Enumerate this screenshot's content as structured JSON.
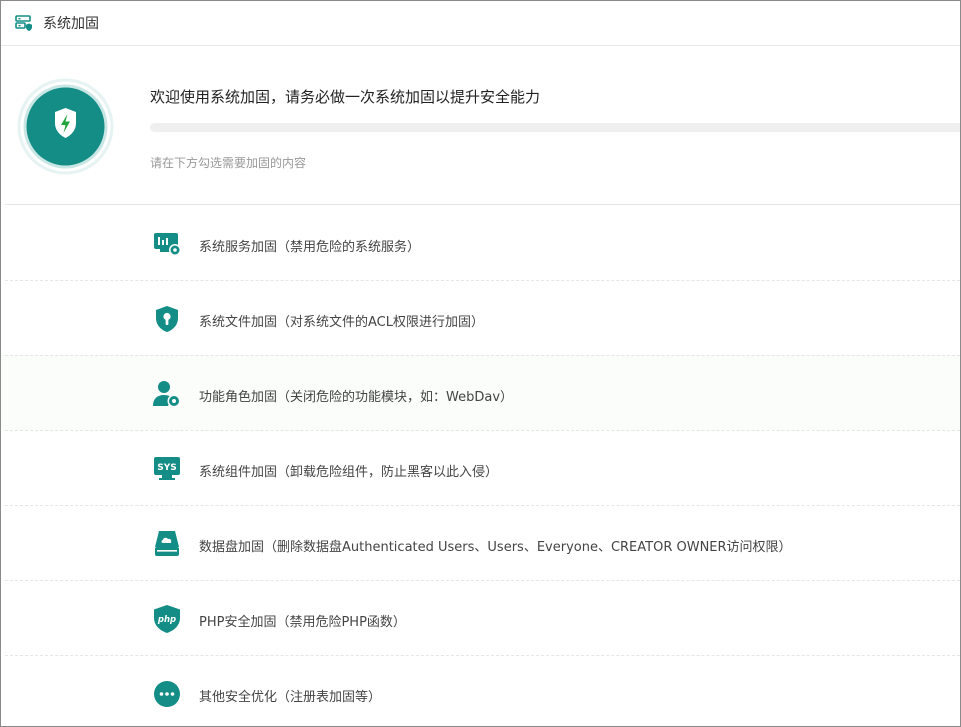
{
  "header": {
    "title": "系统加固",
    "icon": "server-shield-icon"
  },
  "hero": {
    "title": "欢迎使用系统加固，请务必做一次系统加固以提升安全能力",
    "subtitle": "请在下方勾选需要加固的内容",
    "progress": 0,
    "icon": "shield-bolt-icon"
  },
  "colors": {
    "accent": "#138d86",
    "accent_dark": "#0e7a73",
    "progress": "#20a53a"
  },
  "items": [
    {
      "label": "系统服务加固（禁用危险的系统服务）",
      "icon": "monitor-chart-gear-icon"
    },
    {
      "label": "系统文件加固（对系统文件的ACL权限进行加固）",
      "icon": "shield-keyhole-icon"
    },
    {
      "label": "功能角色加固（关闭危险的功能模块，如：WebDav）",
      "icon": "user-gear-icon"
    },
    {
      "label": "系统组件加固（卸载危险组件，防止黑客以此入侵）",
      "icon": "sys-monitor-icon"
    },
    {
      "label": "数据盘加固（删除数据盘Authenticated Users、Users、Everyone、CREATOR OWNER访问权限）",
      "icon": "disk-cloud-icon"
    },
    {
      "label": "PHP安全加固（禁用危险PHP函数）",
      "icon": "php-shield-icon"
    },
    {
      "label": "其他安全优化（注册表加固等）",
      "icon": "more-dots-icon"
    }
  ]
}
